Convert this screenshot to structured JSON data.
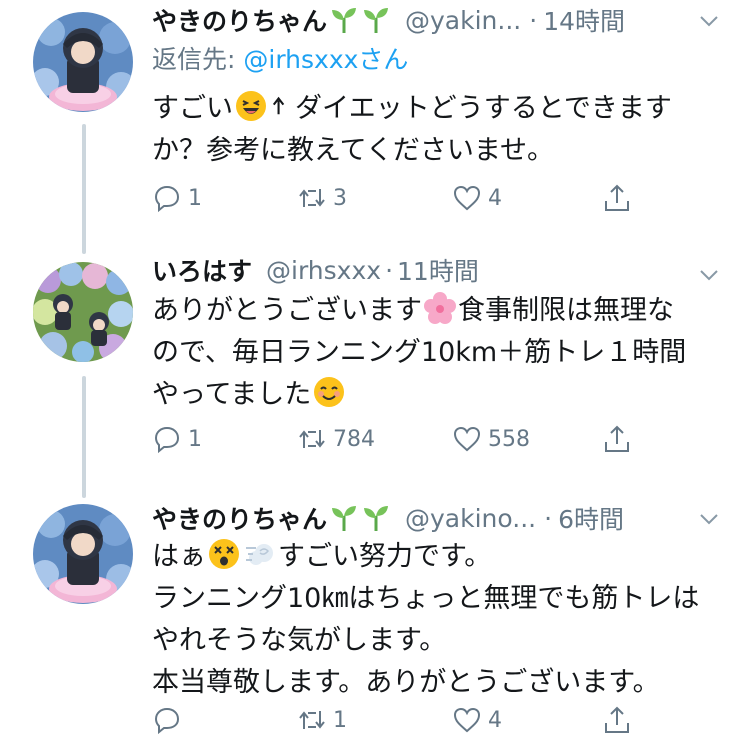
{
  "tweets": [
    {
      "name": "やきのりちゃん",
      "handle": "@yakin...",
      "separator": "·",
      "time": "14時間",
      "reply_prefix": "返信先: ",
      "reply_to": "@irhsxxxさん",
      "body": {
        "l1a": "すごい",
        "l1b": "ダイエットどうするとできます",
        "l2": "か？参考に教えてくださいませ。"
      },
      "replies": "1",
      "retweets": "3",
      "likes": "4"
    },
    {
      "name": "いろはす",
      "handle": "@irhsxxx",
      "separator": "·",
      "time": "11時間",
      "body": {
        "l1a": "ありがとうございます",
        "l1b": "食事制限は無理な",
        "l2": "ので、毎日ランニング10km＋筋トレ１時間",
        "l3": "やってました"
      },
      "replies": "1",
      "retweets": "784",
      "likes": "558"
    },
    {
      "name": "やきのりちゃん",
      "handle": "@yakino...",
      "separator": "·",
      "time": "6時間",
      "body": {
        "l1a": "はぁ",
        "l1b": "すごい努力です。",
        "l2": "ランニング10㎞はちょっと無理でも筋トレは",
        "l3": "やれそうな気がします。",
        "l4": "本当尊敬します。ありがとうございます。"
      },
      "replies": "",
      "retweets": "1",
      "likes": "4"
    }
  ],
  "icons": [
    "reply-icon",
    "retweet-icon",
    "like-icon",
    "share-icon",
    "chevron-down-icon",
    "sprout-emoji",
    "laughing-emoji",
    "arrow-up-emoji",
    "cherry-blossom-emoji",
    "smile-emoji",
    "dizzy-face-emoji",
    "dash-emoji"
  ],
  "colors": {
    "text": "#14171a",
    "secondary": "#657786",
    "link": "#1da1f2",
    "thread_line": "#ccd6dd"
  }
}
